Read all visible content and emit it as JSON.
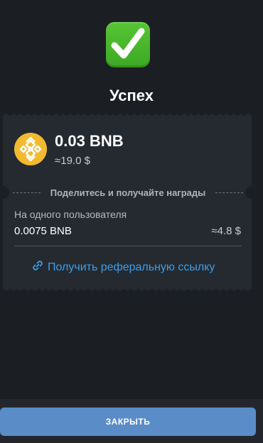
{
  "status": {
    "icon": "check-mark-icon",
    "title": "Успех"
  },
  "reward": {
    "coin_icon": "bnb-icon",
    "amount": "0.03 BNB",
    "amount_usd": "≈19.0 $",
    "share_text": "Поделитесь и получайте награды",
    "per_user_label": "На одного пользователя",
    "per_user_amount": "0.0075 BNB",
    "per_user_usd": "≈4.8 $",
    "link_icon": "link-icon",
    "referral_link": "Получить реферальную ссылку"
  },
  "footer": {
    "close_label": "ЗАКРЫТЬ"
  },
  "colors": {
    "background": "#1b1f24",
    "card": "#252a30",
    "accent": "#3b9fe8",
    "button": "#5a8dc8",
    "coin": "#f3ba2f",
    "success": "#4cb82d"
  }
}
